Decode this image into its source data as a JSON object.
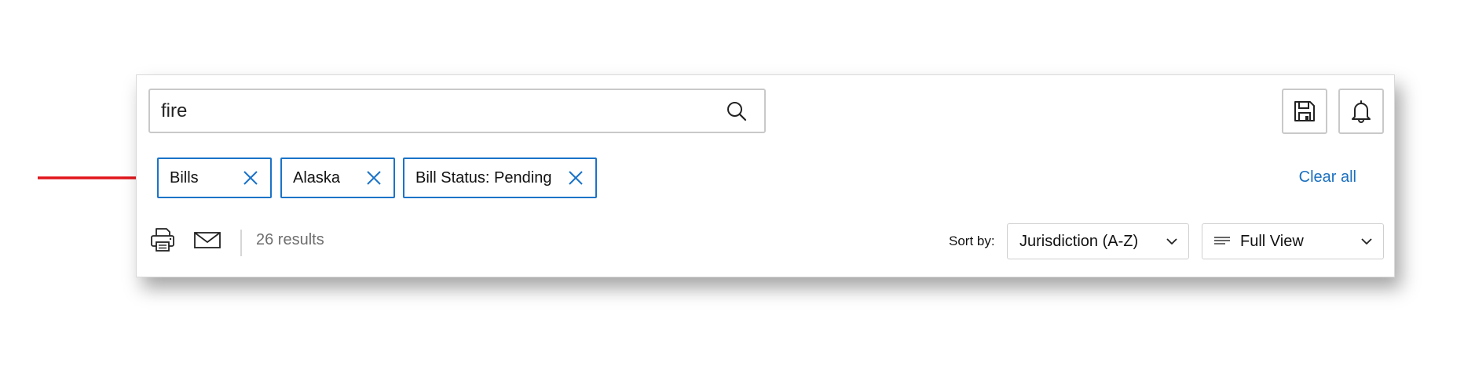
{
  "search": {
    "value": "fire",
    "icon": "search-icon"
  },
  "toolbar": {
    "save_icon": "floppy-disk-icon",
    "alert_icon": "bell-icon"
  },
  "filters": {
    "chips": [
      {
        "label": "Bills"
      },
      {
        "label": "Alaska"
      },
      {
        "label": "Bill Status: Pending"
      }
    ],
    "clear_all_label": "Clear all"
  },
  "results_bar": {
    "print_icon": "printer-icon",
    "email_icon": "envelope-icon",
    "results_text": "26 results",
    "sort_label": "Sort by:",
    "sort_value": "Jurisdiction (A-Z)",
    "view_icon": "list-lines-icon",
    "view_value": "Full View"
  },
  "annotation": {
    "arrow_color": "#e0161c"
  },
  "colors": {
    "accent": "#1a73c8",
    "link": "#1a6fbf",
    "muted_text": "#6e6e6e"
  }
}
